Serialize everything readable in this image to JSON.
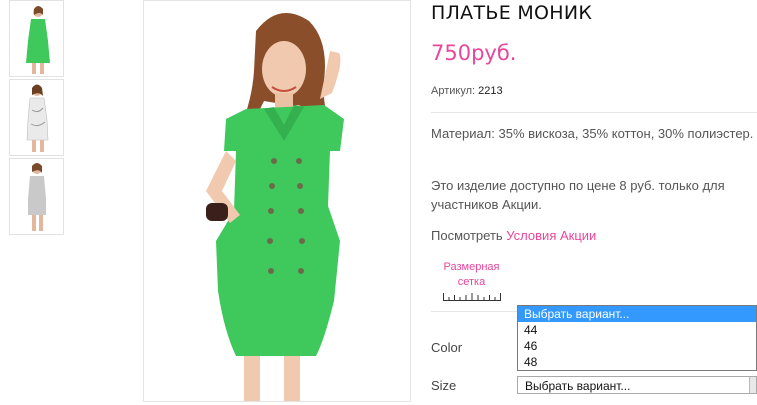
{
  "product": {
    "title": "ПЛАТЬЕ МОНИК",
    "price": "750руб.",
    "sku_label": "Артикул:",
    "sku_value": "2213",
    "material": "Материал: 35% вискоза, 35% коттон, 30% полиэстер.",
    "promo_price_text": "Это изделие доступно по цене 8 руб. только для участников Акции.",
    "promo_prefix": "Посмотреть",
    "promo_link": "Условия Акции",
    "size_chart_line1": "Размерная",
    "size_chart_line2": "сетка"
  },
  "options": {
    "color_label": "Color",
    "size_label": "Size",
    "color_dropdown_items": [
      "Выбрать вариант...",
      "44",
      "46",
      "48"
    ],
    "size_select_value": "Выбрать вариант..."
  },
  "colors": {
    "accent": "#e8479a",
    "dress_green": "#3fc95c",
    "select_highlight": "#3399ff"
  },
  "icons": {
    "size_chart": "ruler-icon"
  }
}
